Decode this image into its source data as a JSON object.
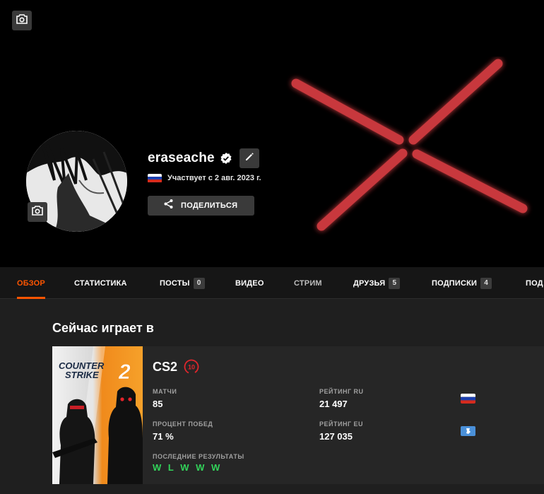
{
  "profile": {
    "username": "eraseache",
    "member_since": "Участвует с 2 авг. 2023 г.",
    "share_label": "ПОДЕЛИТЬСЯ"
  },
  "tabs": [
    {
      "label": "ОБЗОР",
      "state": "active"
    },
    {
      "label": "СТАТИСТИКА"
    },
    {
      "label": "ПОСТЫ",
      "badge": "0"
    },
    {
      "label": "ВИДЕО"
    },
    {
      "label": "СТРИМ",
      "state": "dim"
    },
    {
      "label": "ДРУЗЬЯ",
      "badge": "5"
    },
    {
      "label": "ПОДПИСКИ",
      "badge": "4"
    },
    {
      "label": "ПОД"
    }
  ],
  "now_playing": {
    "title": "Сейчас играет в",
    "game": {
      "cover_text_line1": "COUNTER",
      "cover_text_line2": "STRIKE",
      "cover_number": "2",
      "name": "CS2",
      "level": "10",
      "matches_label": "МАТЧИ",
      "matches_value": "85",
      "winrate_label": "ПРОЦЕНТ ПОБЕД",
      "winrate_value": "71 %",
      "rating_ru_label": "РЕЙТИНГ RU",
      "rating_ru_value": "21 497",
      "rating_eu_label": "РЕЙТИНГ EU",
      "rating_eu_value": "127 035",
      "recent_label": "ПОСЛЕДНИЕ РЕЗУЛЬТАТЫ",
      "recent_results": "W L W W W"
    }
  },
  "colors": {
    "accent": "#ff5500",
    "win_green": "#32d35a",
    "x_red": "#c8373c",
    "level_red": "#e0262c"
  },
  "icons": [
    "camera-icon",
    "verified-icon",
    "pencil-icon",
    "share-icon",
    "russia-flag-icon",
    "eu-region-icon"
  ]
}
